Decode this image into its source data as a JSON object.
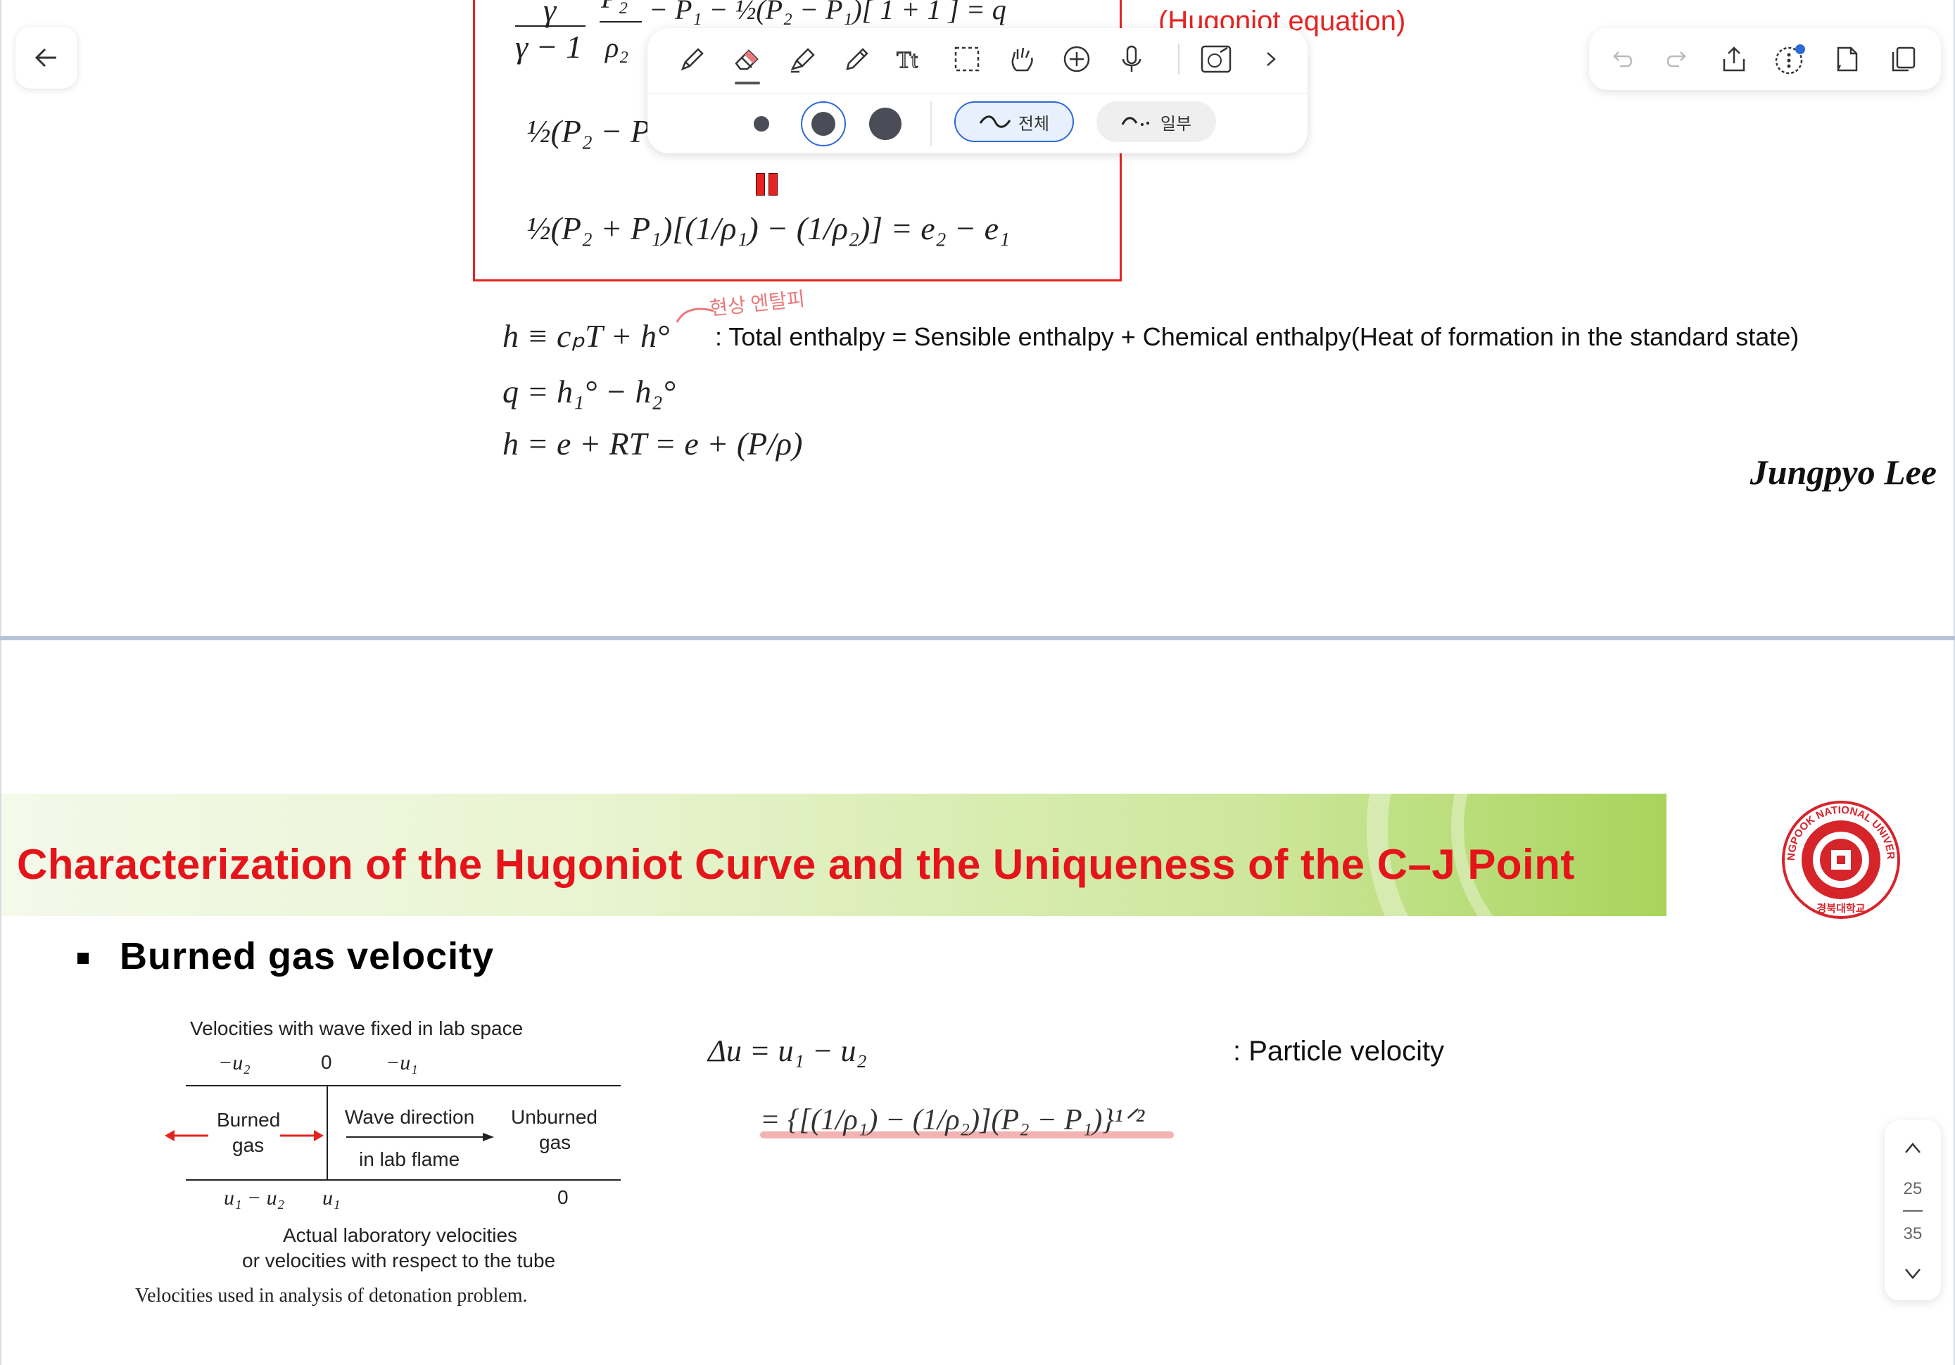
{
  "page1": {
    "eq_fragment_top_left": "γ",
    "eq_fragment_gamma_minus": "γ − 1",
    "eq_fragment_p2": "P₂",
    "eq_fragment_rho2": "ρ₂",
    "eq_fragment_rest": "−  P₁  −  ½(P₂ − P₁)[ 1   +  1 ] = q",
    "eq_fragment_second": "½(P₂ − P",
    "eq_third": "½(P₂ + P₁)[(1/ρ₁) − (1/ρ₂)] = e₂ − e₁",
    "hugoniot_label": "(Hugoniot equation)",
    "handwritten_note": "현상 엔탈피",
    "enthalpy_eq": "h ≡ cₚT + h°",
    "enthalpy_desc": ": Total enthalpy = Sensible enthalpy + Chemical enthalpy(Heat of formation in the standard state)",
    "q_eq": "q = h₁° − h₂°",
    "h_eq": "h = e + RT = e + (P/ρ)",
    "author": "Jungpyo Lee"
  },
  "toolbar": {
    "width_all_label": "전체",
    "width_part_label": "일부",
    "tools": [
      "pen-icon",
      "eraser-icon",
      "highlighter-icon",
      "pencil-icon",
      "text-icon",
      "lasso-select-icon",
      "hand-icon",
      "add-icon",
      "microphone-icon",
      "sticker-icon",
      "chevron-right-icon"
    ]
  },
  "right_toolbar": {
    "icons": [
      "undo-icon",
      "redo-icon",
      "share-icon",
      "more-icon",
      "new-page-icon",
      "duplicate-icon"
    ],
    "notification_color": "#2c6ad8"
  },
  "page_nav": {
    "current": "25",
    "total": "35"
  },
  "page2": {
    "title": "Characterization of the Hugoniot Curve and the Uniqueness of the C–J Point",
    "subtitle": "Burned gas velocity",
    "diagram": {
      "top_caption": "Velocities with wave fixed in lab space",
      "top_u2": "−u₂",
      "top_zero": "0",
      "top_u1": "−u₁",
      "burned": "Burned",
      "gas1": "gas",
      "wave_direction": "Wave direction",
      "in_lab_flame": "in lab flame",
      "unburned": "Unburned",
      "gas2": "gas",
      "bottom_u1_u2": "u₁ − u₂",
      "bottom_u1": "u₁",
      "bottom_zero": "0",
      "bottom_caption1": "Actual laboratory velocities",
      "bottom_caption2": "or velocities with respect to the tube",
      "figure_caption": "Velocities used in analysis of detonation problem."
    },
    "delta_u_eq": "Δu = u₁ − u₂",
    "delta_u_expr": "= {[(1/ρ₁) − (1/ρ₂)](P₂ − P₁)}¹ᐟ²",
    "particle_velocity": ":  Particle velocity",
    "logo_text": "KYUNGPOOK NATIONAL UNIVERSITY",
    "logo_text_kr": "경북대학교",
    "title_color": "#e5141b",
    "accent_red": "#e52421"
  }
}
